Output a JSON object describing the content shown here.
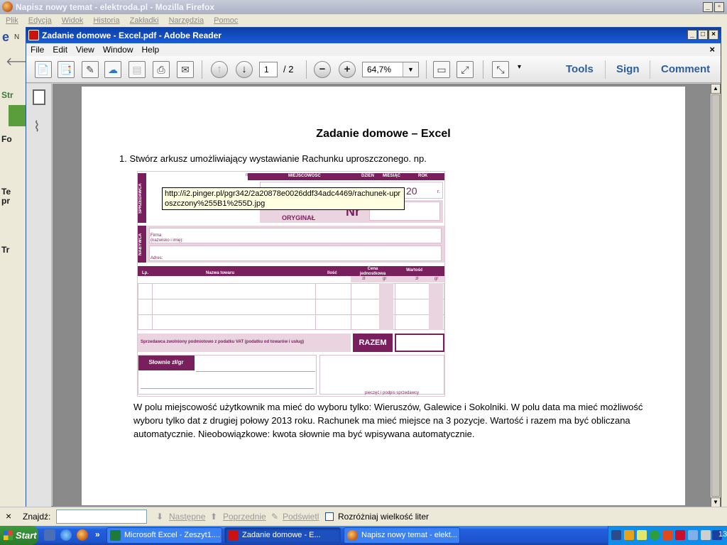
{
  "firefox": {
    "title": "Napisz nowy temat - elektroda.pl - Mozilla Firefox",
    "menu": [
      "Plik",
      "Edycja",
      "Widok",
      "Historia",
      "Zakładki",
      "Narzędzia",
      "Pomoc"
    ],
    "left_fragments": [
      "Str",
      "Fo",
      "Te",
      "pr",
      "Tr"
    ],
    "top_icon_letter": "e",
    "nav_fragment": "N"
  },
  "reader": {
    "title": "Zadanie domowe - Excel.pdf - Adobe Reader",
    "menu": [
      "File",
      "Edit",
      "View",
      "Window",
      "Help"
    ],
    "toolbar": {
      "page_current": "1",
      "page_total": "/ 2",
      "zoom": "64,7%",
      "tools_label": "Tools",
      "sign_label": "Sign",
      "comment_label": "Comment"
    }
  },
  "document": {
    "title": "Zadanie domowe – Excel",
    "item": "1.  Stwórz arkusz umożliwiający wystawianie Rachunku uproszczonego. np.",
    "paragraph": "W polu miejscowość użytkownik ma mieć do wyboru tylko: Wieruszów, Galewice i Sokolniki. W polu data ma mieć możliwość wyboru tylko dat z drugiej połowy 2013 roku. Rachunek ma mieć miejsce na 3 pozycje. Wartość i razem ma być obliczana automatycznie. Nieobowiązkowe: kwota słownie ma być wpisywana automatycznie.",
    "invoice": {
      "mp": "m.p.",
      "miejscowosc": "MIEJSCOWOŚĆ",
      "dzien": "DZIEŃ",
      "miesiac": "MIESIĄC",
      "rok": "ROK",
      "year_prefix": "20",
      "r": "r.",
      "sprzedawca": "SPRZEDAWCA",
      "oryginal": "ORYGINAŁ",
      "nr": "Nr",
      "nabywca": "NABYWCA",
      "firma": "Firma",
      "nazwisko": "(nazwisko i imię):",
      "adres": "Adres:",
      "lp": "Lp.",
      "nazwa_towaru": "Nazwa towaru",
      "ilosc": "Ilość",
      "cena": "Cena jednostkowa",
      "wartosc": "Wartość",
      "zl": "zł",
      "gr": "gr",
      "zwolniony": "Sprzedawca zwolniony podmiotowo z podatku VAT (podatku od towarów i usług)",
      "razem": "RAZEM",
      "slownie": "Słownie zł/gr",
      "pieczec": "pieczęć i podpis sprzedawcy"
    },
    "tooltip": "http://i2.pinger.pl/pgr342/2a20878e0026ddf34adc4469/rachunek-uproszczony%255B1%255D.jpg"
  },
  "findbar": {
    "close": "×",
    "label": "Znajdź:",
    "value": "",
    "next": "Następne",
    "prev": "Poprzednie",
    "highlight": "Podświetl",
    "match_case": "Rozróżniaj wielkość liter"
  },
  "taskbar": {
    "start": "Start",
    "more": "»",
    "tasks": [
      {
        "label": "Microsoft Excel - Zeszyt1....",
        "active": false
      },
      {
        "label": "Zadanie domowe - E...",
        "active": true
      },
      {
        "label": "Napisz nowy temat - elekt...",
        "active": false
      }
    ],
    "clock": "13"
  }
}
